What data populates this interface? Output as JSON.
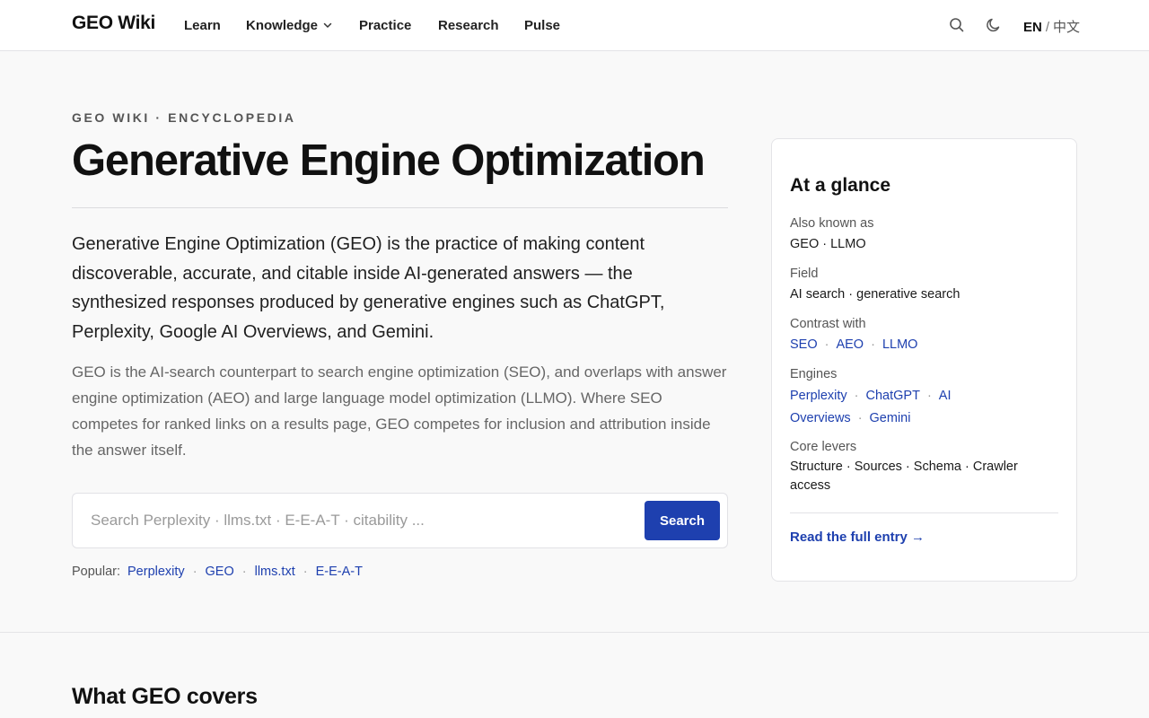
{
  "header": {
    "brand": "GEO Wiki",
    "nav": [
      {
        "label": "Learn"
      },
      {
        "label": "Knowledge"
      },
      {
        "label": "Practice"
      },
      {
        "label": "Research"
      },
      {
        "label": "Pulse"
      }
    ],
    "lang_active": "EN",
    "lang_separator": "/",
    "lang_alt": "中文",
    "icons": [
      "search-icon",
      "moon-icon",
      "chevron-down-icon"
    ]
  },
  "hero": {
    "eyebrow": "GEO WIKI · ENCYCLOPEDIA",
    "title": "Generative Engine Optimization",
    "lead": "Generative Engine Optimization (GEO) is the practice of making content discoverable, accurate, and citable inside AI-generated answers — the synthesized responses produced by generative engines such as ChatGPT, Perplexity, Google AI Overviews, and Gemini.",
    "sub": "GEO is the AI-search counterpart to search engine optimization (SEO), and overlaps with answer engine optimization (AEO) and large language model optimization (LLMO). Where SEO competes for ranked links on a results page, GEO competes for inclusion and attribution inside the answer itself.",
    "search": {
      "placeholder": "Search Perplexity · llms.txt · E-E-A-T · citability ...",
      "value": "",
      "button": "Search"
    },
    "popular": {
      "label": "Popular:",
      "links": [
        "Perplexity",
        "GEO",
        "llms.txt",
        "E-E-A-T"
      ],
      "separator": "·"
    }
  },
  "glance": {
    "title": "At a glance",
    "also_known_label": "Also known as",
    "also_known_value": "GEO · LLMO",
    "field_label": "Field",
    "field_value": "AI search · generative search",
    "contrast_label": "Contrast with",
    "contrast_links": [
      "SEO",
      "AEO",
      "LLMO"
    ],
    "engines_label": "Engines",
    "engines_links": [
      "Perplexity",
      "ChatGPT",
      "AI Overviews",
      "Gemini"
    ],
    "levers_label": "Core levers",
    "levers_value": "Structure · Sources · Schema · Crawler access",
    "cta": "Read the full entry →"
  },
  "section": {
    "title": "What GEO covers"
  },
  "colors": {
    "accent": "#1e40af",
    "background": "#f9f9f9",
    "surface": "#ffffff",
    "border": "#e4e4e7",
    "text": "#111111",
    "muted": "#666666"
  }
}
